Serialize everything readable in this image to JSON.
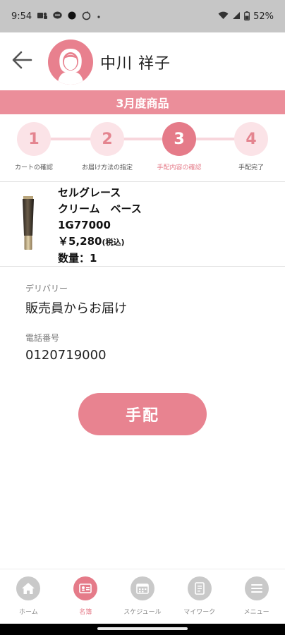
{
  "status_bar": {
    "time": "9:54",
    "battery": "52%"
  },
  "header": {
    "user_name": "中川 祥子"
  },
  "banner": {
    "title": "3月度商品"
  },
  "stepper": {
    "steps": [
      {
        "number": "1",
        "label": "カートの確認"
      },
      {
        "number": "2",
        "label": "お届け方法の指定"
      },
      {
        "number": "3",
        "label": "手配内容の確認"
      },
      {
        "number": "4",
        "label": "手配完了"
      }
    ],
    "active_step": 3
  },
  "product": {
    "name_line1": "セルグレース",
    "name_line2": "クリーム　ベース",
    "code": "1G77000",
    "price": "￥5,280",
    "tax_note": "(税込)",
    "quantity": "数量：1"
  },
  "delivery": {
    "label": "デリバリー",
    "value": "販売員からお届け"
  },
  "phone": {
    "label": "電話番号",
    "value": "0120719000"
  },
  "order_button": {
    "label": "手配"
  },
  "bottom_nav": {
    "items": [
      {
        "label": "ホーム",
        "icon": "home-icon"
      },
      {
        "label": "名簿",
        "icon": "contact-card-icon"
      },
      {
        "label": "スケジュール",
        "icon": "calendar-icon"
      },
      {
        "label": "マイワーク",
        "icon": "mywork-icon"
      },
      {
        "label": "メニュー",
        "icon": "menu-icon"
      }
    ],
    "active_index": 1
  },
  "colors": {
    "accent": "#e57b89",
    "banner": "#eb8e9a",
    "step_inactive": "#fbe3e7",
    "status_bar": "#c6c6c6"
  }
}
